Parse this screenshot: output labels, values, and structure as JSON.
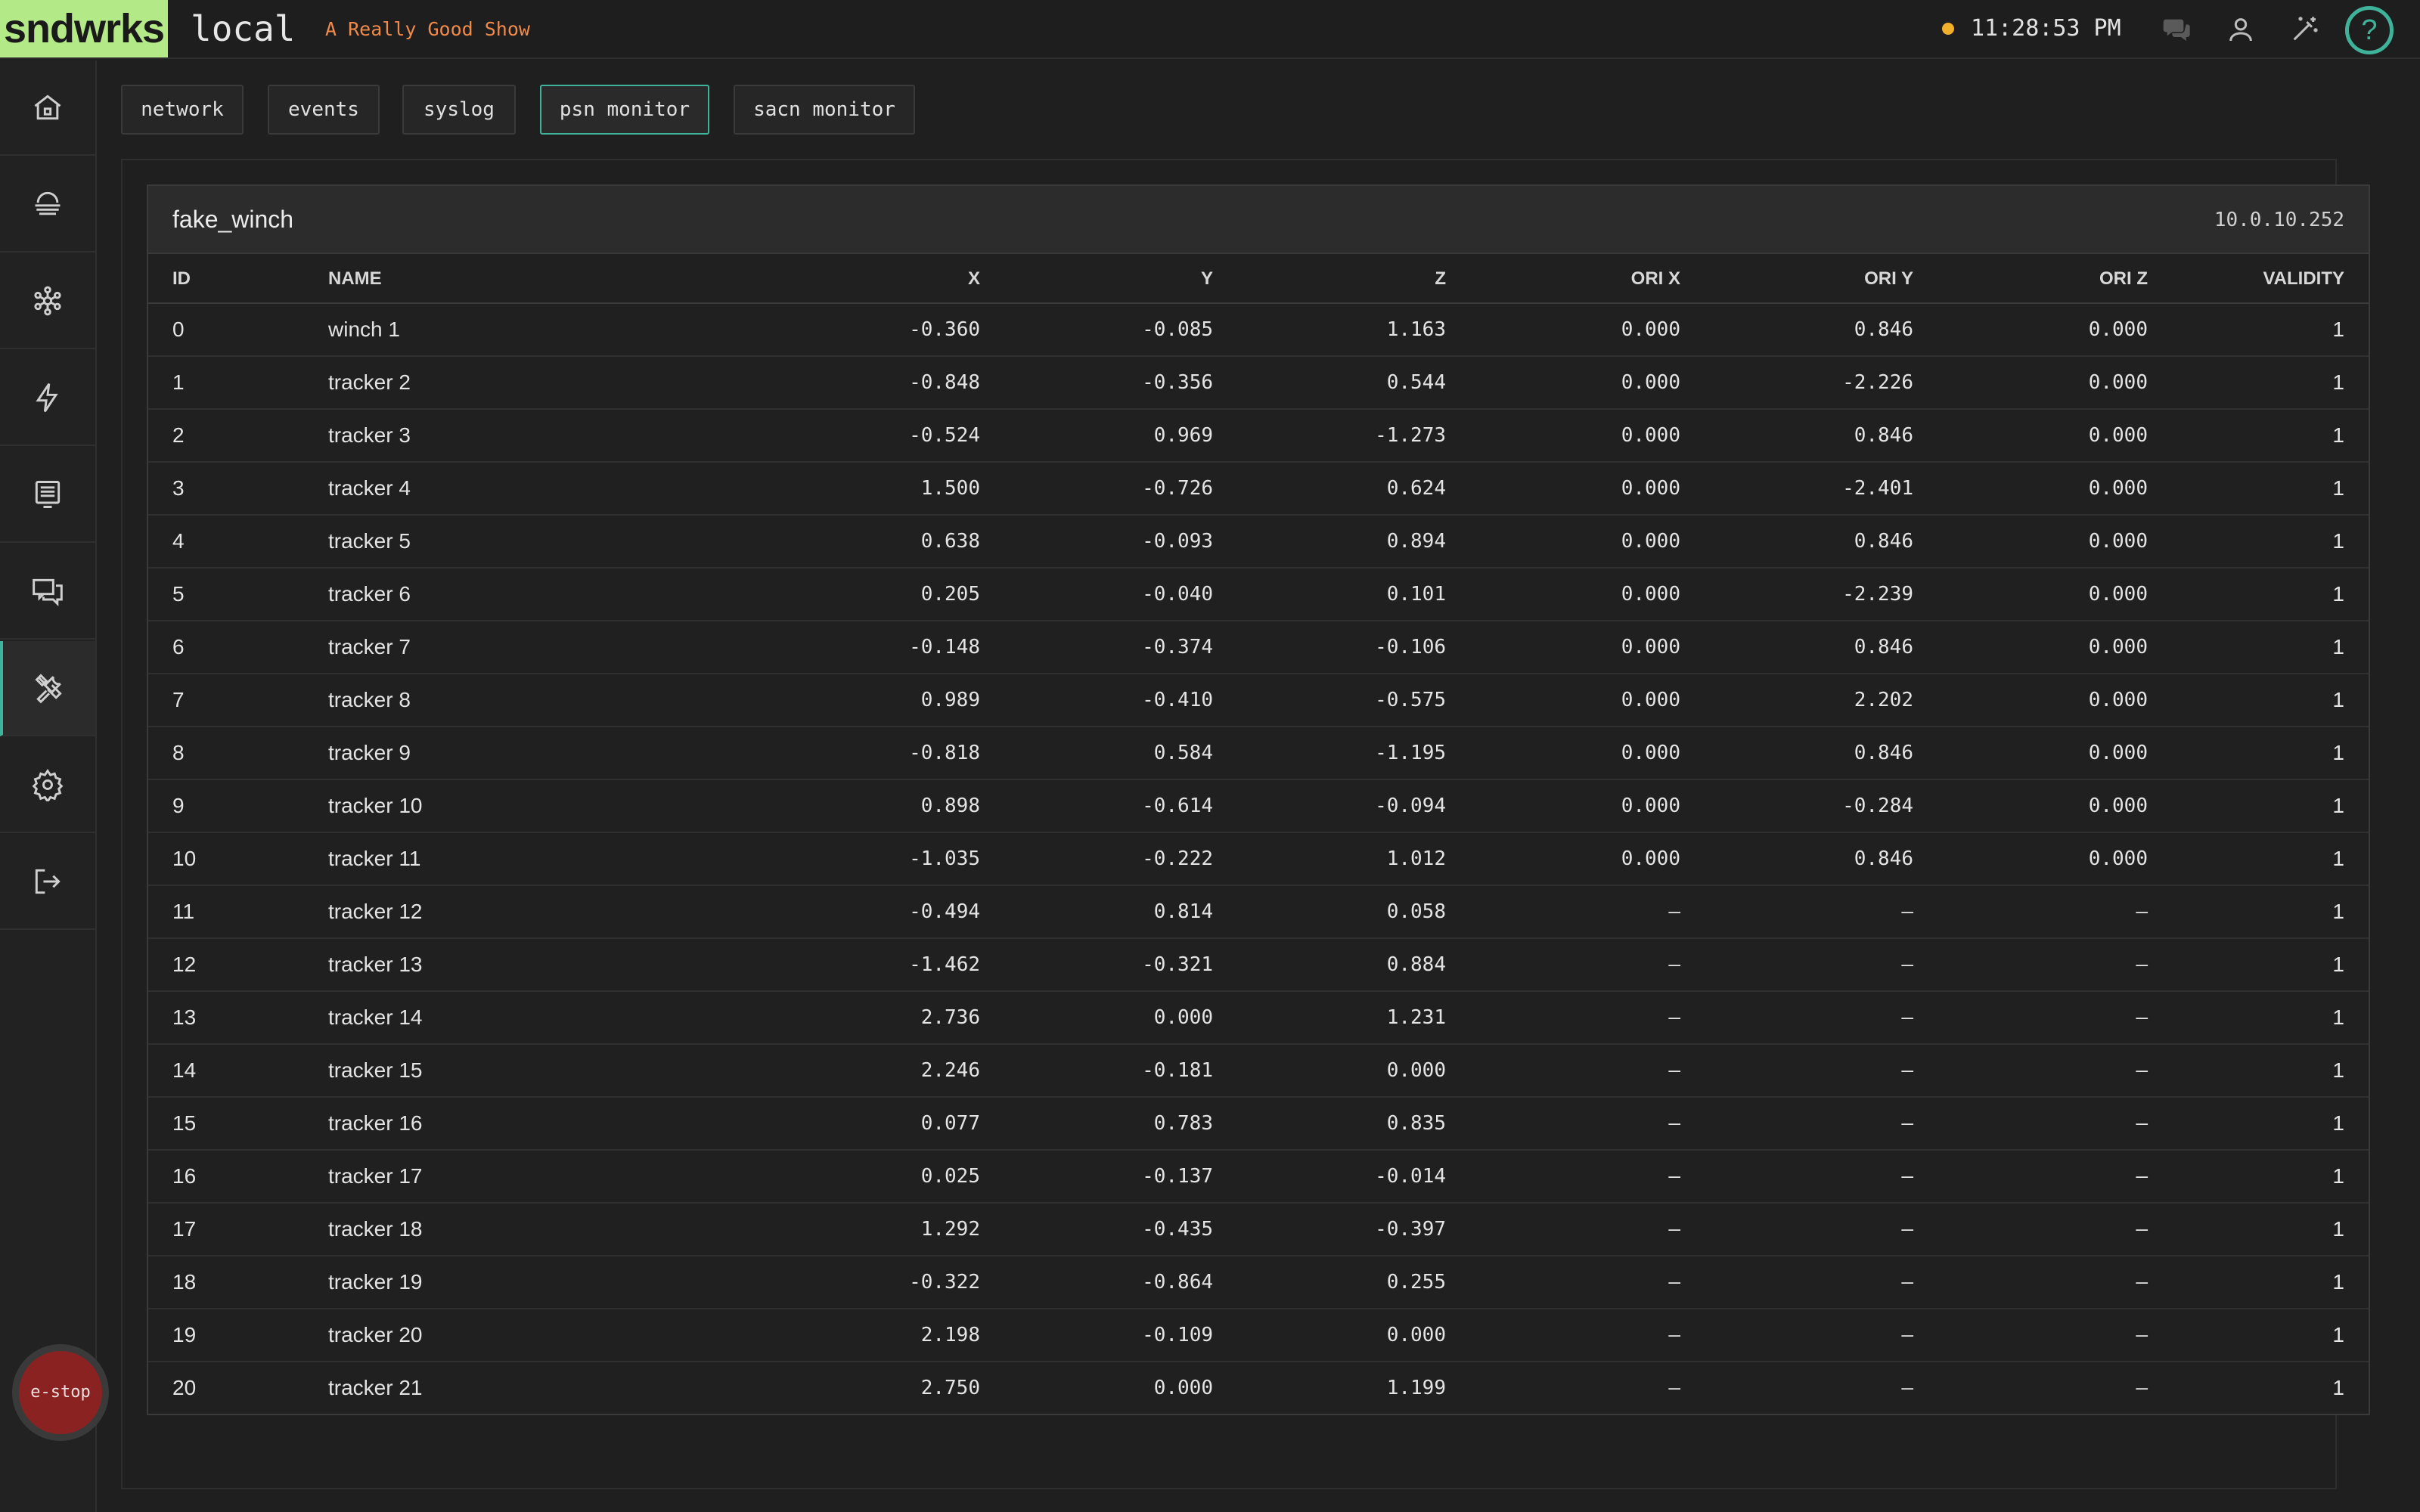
{
  "header": {
    "logo": "sndwrks",
    "site": "local",
    "show": "A Really Good Show",
    "time": "11:28:53 PM",
    "status_color": "#f2b02a",
    "accent_color": "#3fb39a",
    "help": "?"
  },
  "sidebar": {
    "items": [
      {
        "name": "home-icon"
      },
      {
        "name": "devices-icon"
      },
      {
        "name": "network-icon"
      },
      {
        "name": "power-icon"
      },
      {
        "name": "display-icon"
      },
      {
        "name": "chat-icon"
      },
      {
        "name": "tools-icon",
        "active": true
      },
      {
        "name": "settings-icon"
      },
      {
        "name": "logout-icon"
      }
    ],
    "estop": "e-stop"
  },
  "tabs": [
    "network",
    "events",
    "syslog",
    "psn monitor",
    "sacn monitor"
  ],
  "active_tab": "psn monitor",
  "device": {
    "name": "fake_winch",
    "ip": "10.0.10.252"
  },
  "columns": [
    "ID",
    "NAME",
    "X",
    "Y",
    "Z",
    "ORI X",
    "ORI Y",
    "ORI Z",
    "VALIDITY"
  ],
  "rows": [
    [
      "0",
      "winch 1",
      "-0.360",
      "-0.085",
      "1.163",
      "0.000",
      "0.846",
      "0.000",
      "1"
    ],
    [
      "1",
      "tracker 2",
      "-0.848",
      "-0.356",
      "0.544",
      "0.000",
      "-2.226",
      "0.000",
      "1"
    ],
    [
      "2",
      "tracker 3",
      "-0.524",
      "0.969",
      "-1.273",
      "0.000",
      "0.846",
      "0.000",
      "1"
    ],
    [
      "3",
      "tracker 4",
      "1.500",
      "-0.726",
      "0.624",
      "0.000",
      "-2.401",
      "0.000",
      "1"
    ],
    [
      "4",
      "tracker 5",
      "0.638",
      "-0.093",
      "0.894",
      "0.000",
      "0.846",
      "0.000",
      "1"
    ],
    [
      "5",
      "tracker 6",
      "0.205",
      "-0.040",
      "0.101",
      "0.000",
      "-2.239",
      "0.000",
      "1"
    ],
    [
      "6",
      "tracker 7",
      "-0.148",
      "-0.374",
      "-0.106",
      "0.000",
      "0.846",
      "0.000",
      "1"
    ],
    [
      "7",
      "tracker 8",
      "0.989",
      "-0.410",
      "-0.575",
      "0.000",
      "2.202",
      "0.000",
      "1"
    ],
    [
      "8",
      "tracker 9",
      "-0.818",
      "0.584",
      "-1.195",
      "0.000",
      "0.846",
      "0.000",
      "1"
    ],
    [
      "9",
      "tracker 10",
      "0.898",
      "-0.614",
      "-0.094",
      "0.000",
      "-0.284",
      "0.000",
      "1"
    ],
    [
      "10",
      "tracker 11",
      "-1.035",
      "-0.222",
      "1.012",
      "0.000",
      "0.846",
      "0.000",
      "1"
    ],
    [
      "11",
      "tracker 12",
      "-0.494",
      "0.814",
      "0.058",
      "–",
      "–",
      "–",
      "1"
    ],
    [
      "12",
      "tracker 13",
      "-1.462",
      "-0.321",
      "0.884",
      "–",
      "–",
      "–",
      "1"
    ],
    [
      "13",
      "tracker 14",
      "2.736",
      "0.000",
      "1.231",
      "–",
      "–",
      "–",
      "1"
    ],
    [
      "14",
      "tracker 15",
      "2.246",
      "-0.181",
      "0.000",
      "–",
      "–",
      "–",
      "1"
    ],
    [
      "15",
      "tracker 16",
      "0.077",
      "0.783",
      "0.835",
      "–",
      "–",
      "–",
      "1"
    ],
    [
      "16",
      "tracker 17",
      "0.025",
      "-0.137",
      "-0.014",
      "–",
      "–",
      "–",
      "1"
    ],
    [
      "17",
      "tracker 18",
      "1.292",
      "-0.435",
      "-0.397",
      "–",
      "–",
      "–",
      "1"
    ],
    [
      "18",
      "tracker 19",
      "-0.322",
      "-0.864",
      "0.255",
      "–",
      "–",
      "–",
      "1"
    ],
    [
      "19",
      "tracker 20",
      "2.198",
      "-0.109",
      "0.000",
      "–",
      "–",
      "–",
      "1"
    ],
    [
      "20",
      "tracker 21",
      "2.750",
      "0.000",
      "1.199",
      "–",
      "–",
      "–",
      "1"
    ]
  ]
}
